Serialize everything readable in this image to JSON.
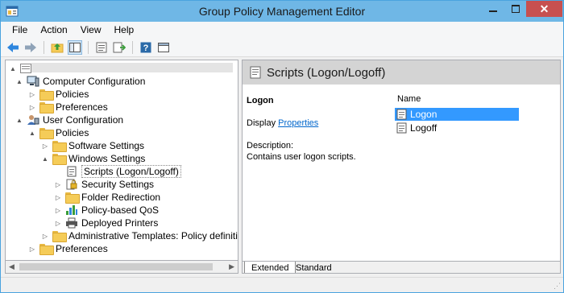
{
  "window": {
    "title": "Group Policy Management Editor"
  },
  "menu": [
    "File",
    "Action",
    "View",
    "Help"
  ],
  "tree": {
    "root_label": "",
    "items": [
      {
        "label": "Computer Configuration",
        "depth": 0,
        "expander": "▲",
        "icon": "computer-icon"
      },
      {
        "label": "Policies",
        "depth": 1,
        "expander": "▷",
        "icon": "folder-icon"
      },
      {
        "label": "Preferences",
        "depth": 1,
        "expander": "▷",
        "icon": "folder-icon"
      },
      {
        "label": "User Configuration",
        "depth": 0,
        "expander": "▲",
        "icon": "user-icon"
      },
      {
        "label": "Policies",
        "depth": 1,
        "expander": "▲",
        "icon": "folder-icon"
      },
      {
        "label": "Software Settings",
        "depth": 2,
        "expander": "▷",
        "icon": "folder-icon"
      },
      {
        "label": "Windows Settings",
        "depth": 2,
        "expander": "▲",
        "icon": "folder-icon"
      },
      {
        "label": "Scripts (Logon/Logoff)",
        "depth": 3,
        "expander": "",
        "icon": "script-icon",
        "selected": true
      },
      {
        "label": "Security Settings",
        "depth": 3,
        "expander": "▷",
        "icon": "security-icon"
      },
      {
        "label": "Folder Redirection",
        "depth": 3,
        "expander": "▷",
        "icon": "folder-icon"
      },
      {
        "label": "Policy-based QoS",
        "depth": 3,
        "expander": "▷",
        "icon": "qos-chart-icon"
      },
      {
        "label": "Deployed Printers",
        "depth": 3,
        "expander": "▷",
        "icon": "printer-icon"
      },
      {
        "label": "Administrative Templates: Policy definitions (A",
        "depth": 2,
        "expander": "▷",
        "icon": "folder-icon"
      },
      {
        "label": "Preferences",
        "depth": 1,
        "expander": "▷",
        "icon": "folder-icon"
      }
    ]
  },
  "right": {
    "title": "Scripts (Logon/Logoff)",
    "detail_heading": "Logon",
    "display_prefix": "Display",
    "display_link": "Properties",
    "description_label": "Description:",
    "description_text": "Contains user logon scripts.",
    "list_header": "Name",
    "list_items": [
      {
        "label": "Logon",
        "selected": true
      },
      {
        "label": "Logoff",
        "selected": false
      }
    ],
    "tabs": [
      "Extended",
      "Standard"
    ]
  },
  "colors": {
    "titlebar": "#6fb7e6",
    "selection": "#3399ff",
    "close": "#c75050",
    "link": "#0066cc"
  }
}
